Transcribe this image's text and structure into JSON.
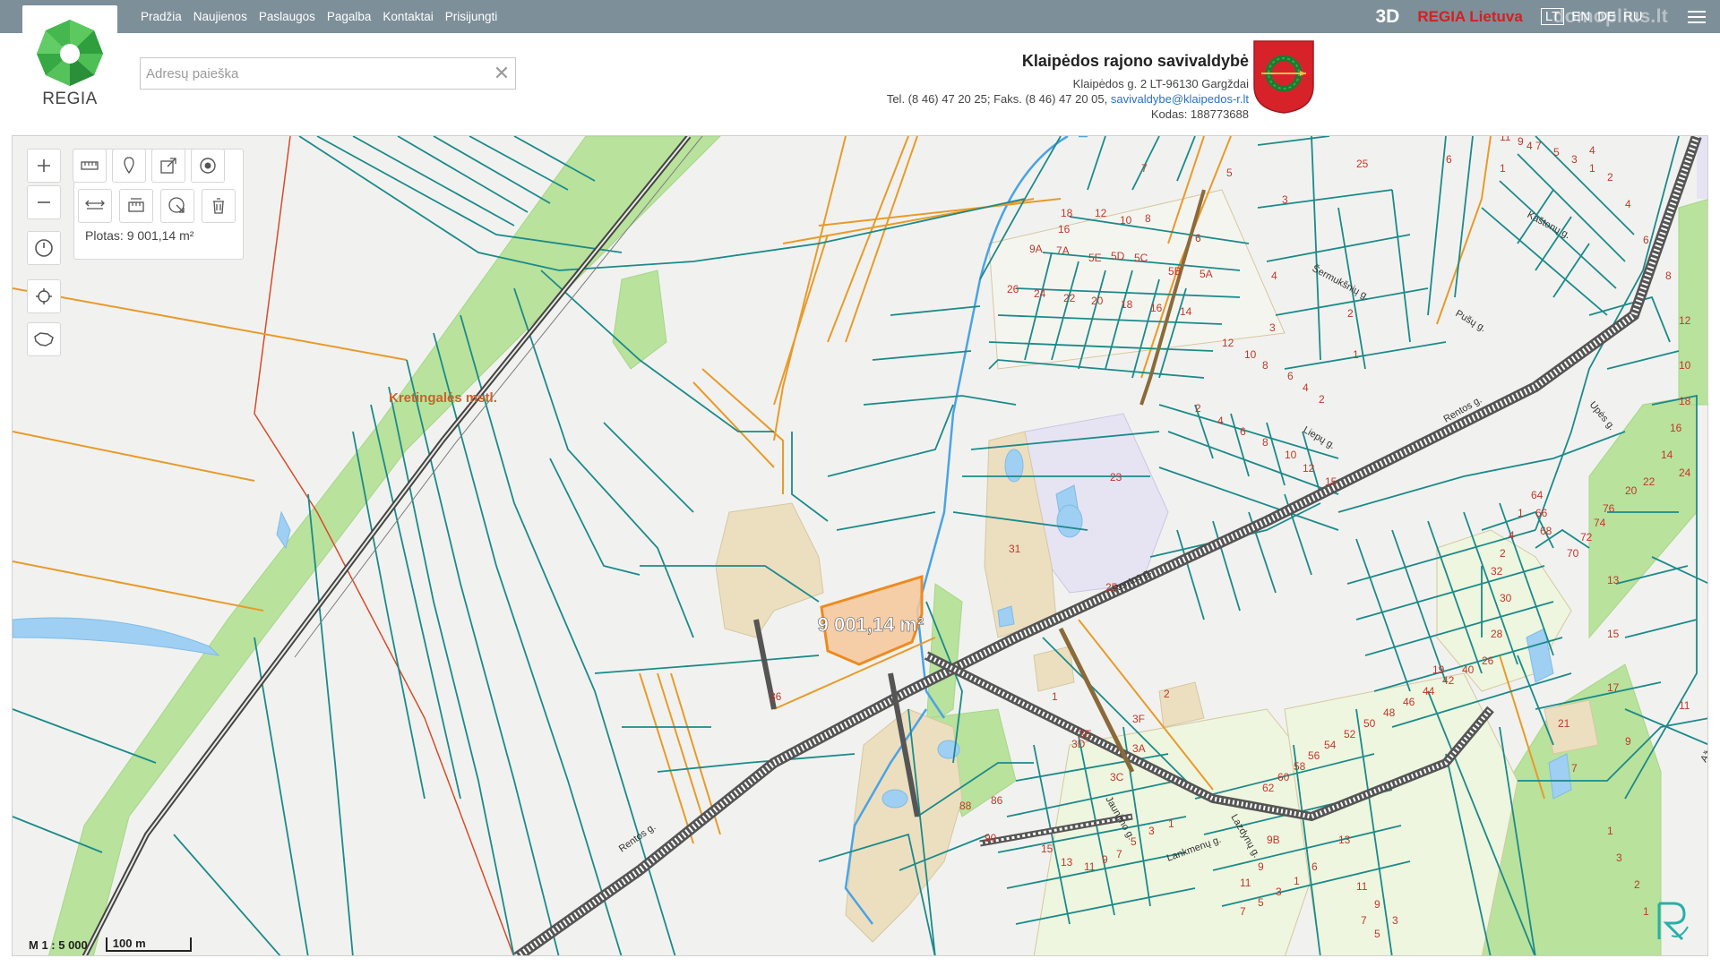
{
  "nav": {
    "items": [
      "Pradžia",
      "Naujienos",
      "Paslaugos",
      "Pagalba",
      "Kontaktai",
      "Prisijungti"
    ]
  },
  "topright": {
    "btn_3d": "3D",
    "regia_lietuva": "REGIA Lietuva",
    "lang_active": "LT",
    "lang_en": "EN",
    "lang_de": "DE",
    "lang_ru": "RU",
    "watermark": "domoplius.lt",
    "menu_icon": "menu-icon"
  },
  "logo": {
    "text": "REGIA",
    "icon": "regia-gem-icon"
  },
  "search": {
    "placeholder": "Adresų paieška",
    "value": "",
    "clear_icon": "close-icon"
  },
  "municipality": {
    "name": "Klaipėdos rajono savivaldybė",
    "address": "Klaipėdos g. 2 LT-96130 Gargždai",
    "phone": "Tel. (8 46) 47 20 25; Faks. (8 46) 47 20 05,",
    "email": "savivaldybe@klaipedos-r.lt",
    "code": "Kodas: 188773688",
    "crest_icon": "coat-of-arms-icon"
  },
  "tools": {
    "zoom_in": "zoom-in-icon",
    "zoom_out": "zoom-out-icon",
    "history": "history-icon",
    "locate": "locate-icon",
    "region": "lithuania-outline-icon",
    "measure_length": "ruler-icon",
    "pin": "pin-icon",
    "export": "export-icon",
    "target": "target-icon",
    "measure_distance": "measure-distance-icon",
    "measure_area": "measure-area-icon",
    "select_area": "select-area-icon",
    "delete": "trash-icon",
    "area_label": "Plotas:",
    "area_value": "9 001,14 m²"
  },
  "map": {
    "highlight_label": "9 001,14 m²",
    "place_label": "Kretingalės mstl.",
    "street_labels": [
      "Rentos g.",
      "Rentos g.",
      "Rentos g.",
      "Liepų g.",
      "Šermukšnių g.",
      "Pušų g.",
      "Kaštonų g.",
      "Upės g.",
      "Ąžuolų g.",
      "Jaunimo g.",
      "Lankmenų g.",
      "Lazdynų g."
    ],
    "parcel_numbers": [
      "7",
      "5",
      "25",
      "6",
      "4",
      "1",
      "4",
      "18",
      "12",
      "10",
      "8",
      "6",
      "16",
      "9A",
      "7A",
      "5E",
      "5D",
      "5C",
      "5B",
      "5A",
      "26",
      "24",
      "22",
      "20",
      "18",
      "16",
      "14",
      "3",
      "4",
      "2",
      "3",
      "1",
      "12",
      "10",
      "8",
      "6",
      "4",
      "2",
      "2",
      "4",
      "6",
      "8",
      "10",
      "12",
      "15",
      "23",
      "31",
      "25",
      "36",
      "1",
      "2",
      "3E",
      "3F",
      "3D",
      "3A",
      "3C",
      "86",
      "88",
      "90",
      "15",
      "13",
      "11",
      "9",
      "7",
      "5",
      "3",
      "1",
      "11",
      "9",
      "9B",
      "7",
      "5",
      "3",
      "1",
      "6",
      "13",
      "11",
      "9",
      "7",
      "5",
      "3",
      "1",
      "4",
      "2",
      "32",
      "30",
      "28",
      "26",
      "40",
      "42",
      "44",
      "46",
      "48",
      "50",
      "52",
      "54",
      "56",
      "58",
      "60",
      "62",
      "64",
      "66",
      "68",
      "70",
      "72",
      "74",
      "76",
      "20",
      "22",
      "24",
      "14",
      "16",
      "18",
      "10",
      "12",
      "8",
      "6",
      "4",
      "2",
      "1",
      "3",
      "5",
      "7",
      "9",
      "11",
      "13",
      "15",
      "17",
      "19",
      "21",
      "7",
      "9",
      "11",
      "1",
      "3",
      "2",
      "1",
      "4",
      "5",
      "9",
      "10",
      "11",
      "1"
    ],
    "scale_ratio": "M 1 : 5 000",
    "scale_bar": "100 m",
    "rc_logo": "rc-logo-icon"
  },
  "colors": {
    "topbar": "#7d8f99",
    "parcel_line": "#1b8a8a",
    "selected_fill": "#f6c89b",
    "selected_stroke": "#ef8a1f",
    "orange_line": "#e99a2a",
    "road": "#5a5a5a",
    "green_area": "#b9e29c",
    "building_area": "#ecdfc0",
    "water": "#9fcff2",
    "label_red": "#c0392b",
    "district_label": "#c8622a"
  }
}
